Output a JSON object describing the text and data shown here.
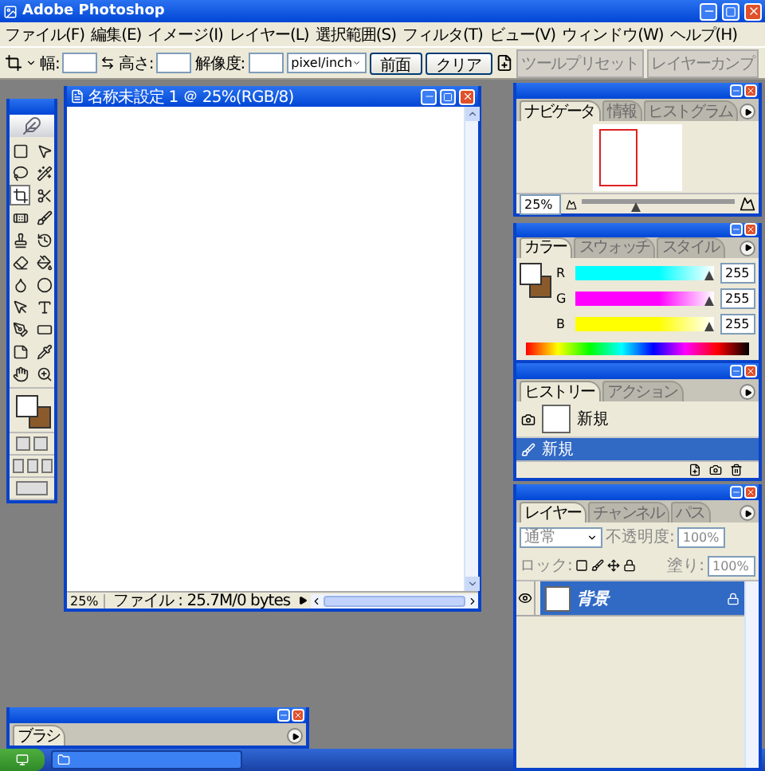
{
  "window": {
    "title": "Adobe Photoshop"
  },
  "menu": [
    "ファイル(F)",
    "編集(E)",
    "イメージ(I)",
    "レイヤー(L)",
    "選択範囲(S)",
    "フィルタ(T)",
    "ビュー(V)",
    "ウィンドウ(W)",
    "ヘルプ(H)"
  ],
  "options_bar": {
    "width_label": "幅:",
    "height_label": "高さ:",
    "resolution_label": "解像度:",
    "unit": "pixel/inch",
    "front_button": "前面",
    "clear_button": "クリア",
    "well_tabs": [
      "ツールプリセット",
      "レイヤーカンプ"
    ]
  },
  "document": {
    "title": "名称未設定 1 ＠ 25%(RGB/8)",
    "zoom": "25%",
    "status": "ファイル : 25.7M/0 bytes"
  },
  "toolbox": {
    "tools": [
      {
        "selected": false
      },
      {
        "selected": false
      },
      {
        "selected": false
      },
      {
        "selected": false
      },
      {
        "selected": true
      },
      {
        "selected": false
      },
      {
        "selected": false
      },
      {
        "selected": false
      },
      {
        "selected": false
      },
      {
        "selected": false
      },
      {
        "selected": false
      },
      {
        "selected": false
      },
      {
        "selected": false
      },
      {
        "selected": false
      },
      {
        "selected": false
      },
      {
        "selected": false
      },
      {
        "selected": false
      },
      {
        "selected": false
      },
      {
        "selected": false
      },
      {
        "selected": false
      },
      {
        "selected": false
      },
      {
        "selected": false
      }
    ]
  },
  "navigator": {
    "tabs": [
      {
        "label": "ナビゲータ",
        "selected": true
      },
      {
        "label": "情報",
        "selected": false
      },
      {
        "label": "ヒストグラム",
        "selected": false
      }
    ],
    "zoom": "25%",
    "level": 0.35
  },
  "color": {
    "tabs": [
      {
        "label": "カラー",
        "selected": true
      },
      {
        "label": "スウォッチ",
        "selected": false
      },
      {
        "label": "スタイル",
        "selected": false
      }
    ],
    "channels": [
      {
        "name": "R",
        "value": "255",
        "level": 1,
        "color": "#00ffff"
      },
      {
        "name": "G",
        "value": "255",
        "level": 1,
        "color": "#ff00ff"
      },
      {
        "name": "B",
        "value": "255",
        "level": 1,
        "color": "#ffff00"
      }
    ]
  },
  "history": {
    "tabs": [
      {
        "label": "ヒストリー",
        "selected": true
      },
      {
        "label": "アクション",
        "selected": false
      }
    ],
    "snapshot": "新規",
    "states": [
      {
        "label": "新規",
        "selected": true
      }
    ]
  },
  "layers": {
    "tabs": [
      {
        "label": "レイヤー",
        "selected": true
      },
      {
        "label": "チャンネル",
        "selected": false
      },
      {
        "label": "パス",
        "selected": false
      }
    ],
    "blend_mode": "通常",
    "opacity_label": "不透明度:",
    "opacity": "100%",
    "lock_label": "ロック:",
    "fill_label": "塗り:",
    "fill": "100%",
    "items": [
      {
        "name": "背景",
        "selected": true,
        "visible": true,
        "locked": true
      }
    ]
  },
  "brushes": {
    "tabs": [
      {
        "label": "ブラシ",
        "selected": true
      }
    ]
  }
}
